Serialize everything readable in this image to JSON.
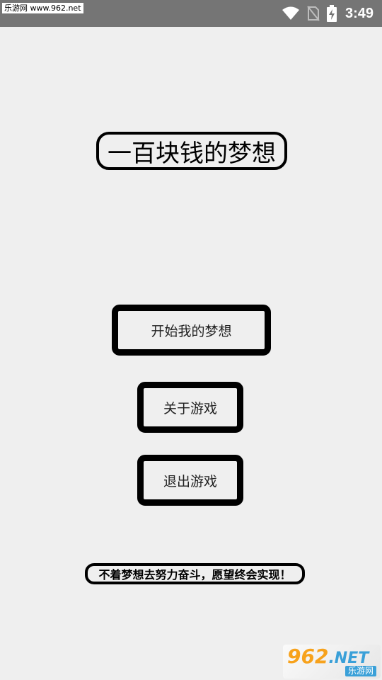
{
  "status_bar": {
    "watermark": "乐游网 www.962.net",
    "time": "3:49",
    "icons": [
      "wifi-icon",
      "no-sim-icon",
      "battery-charging-icon"
    ]
  },
  "title": "一百块钱的梦想",
  "menu": {
    "start_label": "开始我的梦想",
    "about_label": "关于游戏",
    "quit_label": "退出游戏"
  },
  "slogan": "不着梦想去努力奋斗，愿望终会实现！",
  "logo_watermark": {
    "number": "962",
    "suffix": ".NET",
    "subtitle": "乐游网"
  },
  "colors": {
    "background": "#efefef",
    "status_bar": "#757575",
    "border": "#000000",
    "logo_orange": "#f7a21c",
    "logo_blue": "#3aa0d8"
  }
}
